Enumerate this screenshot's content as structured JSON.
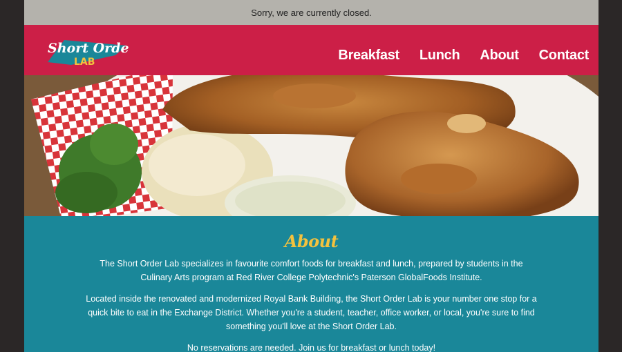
{
  "notice": {
    "text": "Sorry, we are currently closed."
  },
  "brand": {
    "line1": "Short Order",
    "line2": "LAB"
  },
  "nav": {
    "breakfast": "Breakfast",
    "lunch": "Lunch",
    "about": "About",
    "contact": "Contact"
  },
  "about": {
    "heading": "About",
    "p1": "The Short Order Lab specializes in favourite comfort foods for breakfast and lunch, prepared by students in the Culinary Arts program at Red River College Polytechnic's Paterson GlobalFoods Institute.",
    "p2": "Located inside the renovated and modernized Royal Bank Building, the Short Order Lab is your number one stop for a quick bite to eat in the Exchange District. Whether you're a student, teacher, office worker, or local, you're sure to find something you'll love at the Short Order Lab.",
    "p3": "No reservations are needed. Join us for breakfast or lunch today!"
  },
  "colors": {
    "notice_bg": "#b4b2ac",
    "header_bg": "#cc1f47",
    "content_bg": "#1a8799",
    "heading": "#f3c23e",
    "outer_bg": "#2b2727"
  }
}
